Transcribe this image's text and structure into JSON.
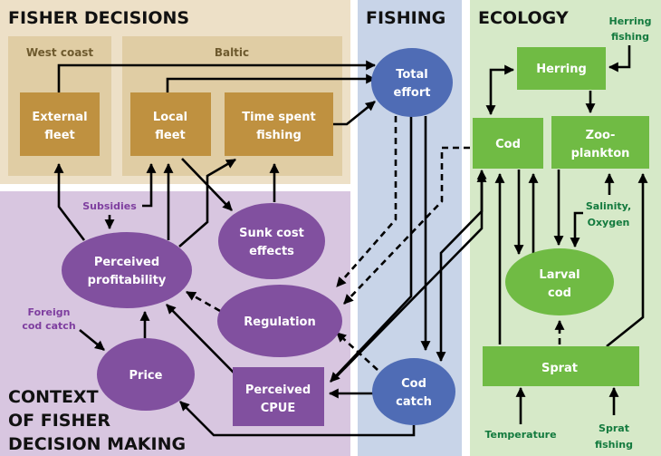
{
  "colors": {
    "fisher_bg": "#ede0c7",
    "fisher_sub_bg": "#e0cda4",
    "fisher_node": "#bf9140",
    "fisher_sub_label": "#6e5a2e",
    "context_bg": "#d8c6e0",
    "context_node": "#81509f",
    "context_ext_label": "#7e3e9f",
    "fishing_bg": "#c8d4e8",
    "fishing_node": "#4f6cb5",
    "ecology_bg": "#d6e9c8",
    "ecology_node": "#70bb44",
    "ecology_ext_label": "#137a3e"
  },
  "sections": {
    "fisher": "FISHER DECISIONS",
    "fishing": "FISHING",
    "ecology": "ECOLOGY",
    "context": [
      "CONTEXT",
      "OF FISHER",
      "DECISION MAKING"
    ]
  },
  "subregions": {
    "west": "West coast",
    "baltic": "Baltic"
  },
  "nodes": {
    "external_fleet": [
      "External",
      "fleet"
    ],
    "local_fleet": [
      "Local",
      "fleet"
    ],
    "time_spent": [
      "Time spent",
      "fishing"
    ],
    "total_effort": [
      "Total",
      "effort"
    ],
    "sunk_cost": [
      "Sunk cost",
      "effects"
    ],
    "perceived_profitability": [
      "Perceived",
      "profitability"
    ],
    "regulation": [
      "Regulation"
    ],
    "price": [
      "Price"
    ],
    "perceived_cpue": [
      "Perceived",
      "CPUE"
    ],
    "cod_catch": [
      "Cod",
      "catch"
    ],
    "herring": [
      "Herring"
    ],
    "cod": [
      "Cod"
    ],
    "zooplankton": [
      "Zoo-",
      "plankton"
    ],
    "larval_cod": [
      "Larval",
      "cod"
    ],
    "sprat": [
      "Sprat"
    ]
  },
  "external_drivers": {
    "subsidies": [
      "Subsidies"
    ],
    "foreign_cod_catch": [
      "Foreign",
      "cod catch"
    ],
    "herring_fishing": [
      "Herring",
      "fishing"
    ],
    "salinity_oxygen": [
      "Salinity,",
      "Oxygen"
    ],
    "temperature": [
      "Temperature"
    ],
    "sprat_fishing": [
      "Sprat",
      "fishing"
    ]
  }
}
